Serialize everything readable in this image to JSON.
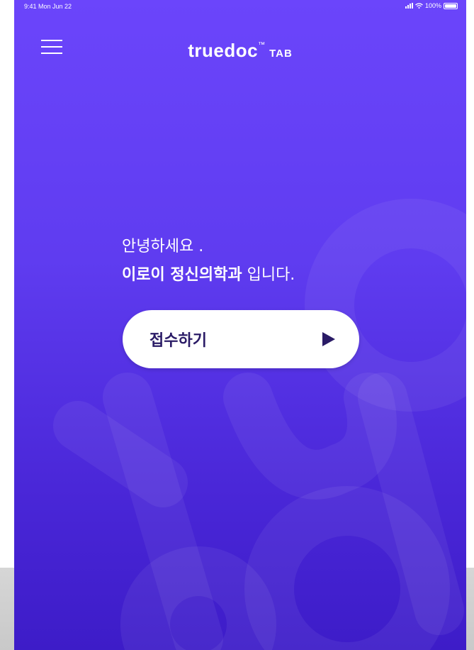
{
  "status_bar": {
    "time": "9:41  Mon Jun 22",
    "battery_percent": "100%"
  },
  "header": {
    "brand_name": "truedoc",
    "brand_tm": "™",
    "brand_suffix": "TAB"
  },
  "greeting": {
    "line1": "안녕하세요 .",
    "clinic_name": "이로이 정신의학과",
    "line2_suffix": " 입니다."
  },
  "checkin_button": {
    "label": "접수하기"
  },
  "colors": {
    "background_top": "#6b45fb",
    "background_bottom": "#3d1cc8",
    "button": "#ffffff",
    "button_text": "#2a1b66"
  },
  "icons": [
    "menu-icon",
    "signal-icon",
    "wifi-icon",
    "battery-icon",
    "play-icon"
  ]
}
